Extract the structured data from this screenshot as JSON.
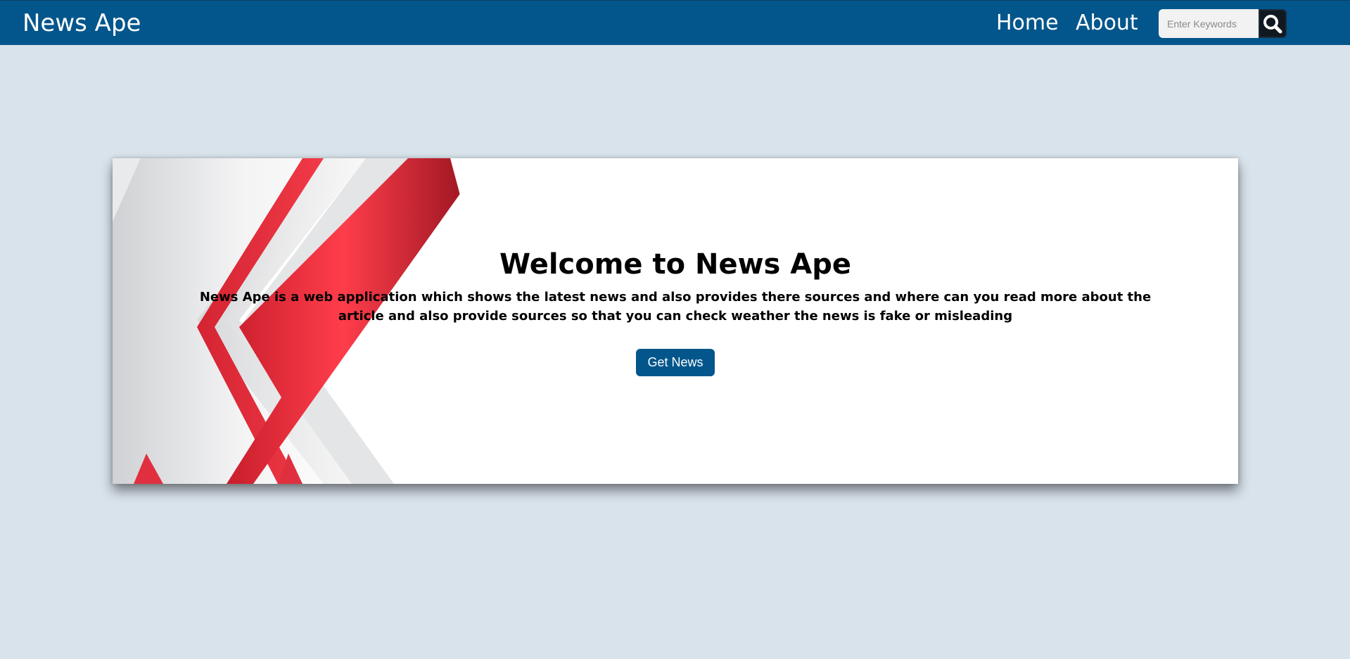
{
  "nav": {
    "brand": "News Ape",
    "links": [
      {
        "label": "Home"
      },
      {
        "label": "About"
      }
    ],
    "search": {
      "placeholder": "Enter Keywords",
      "value": "",
      "button_icon": "search-icon"
    }
  },
  "hero": {
    "title": "Welcome to News Ape",
    "description": "News Ape is a web application which shows the latest news and also provides there sources and where can you read more about the article and also provide sources so that you can check weather the news is fake or misleading",
    "button_label": "Get News"
  },
  "colors": {
    "navbar": "#02568c",
    "page_background": "#d9e3ec",
    "button": "#02568c",
    "accent_red": "#e62e3c"
  }
}
